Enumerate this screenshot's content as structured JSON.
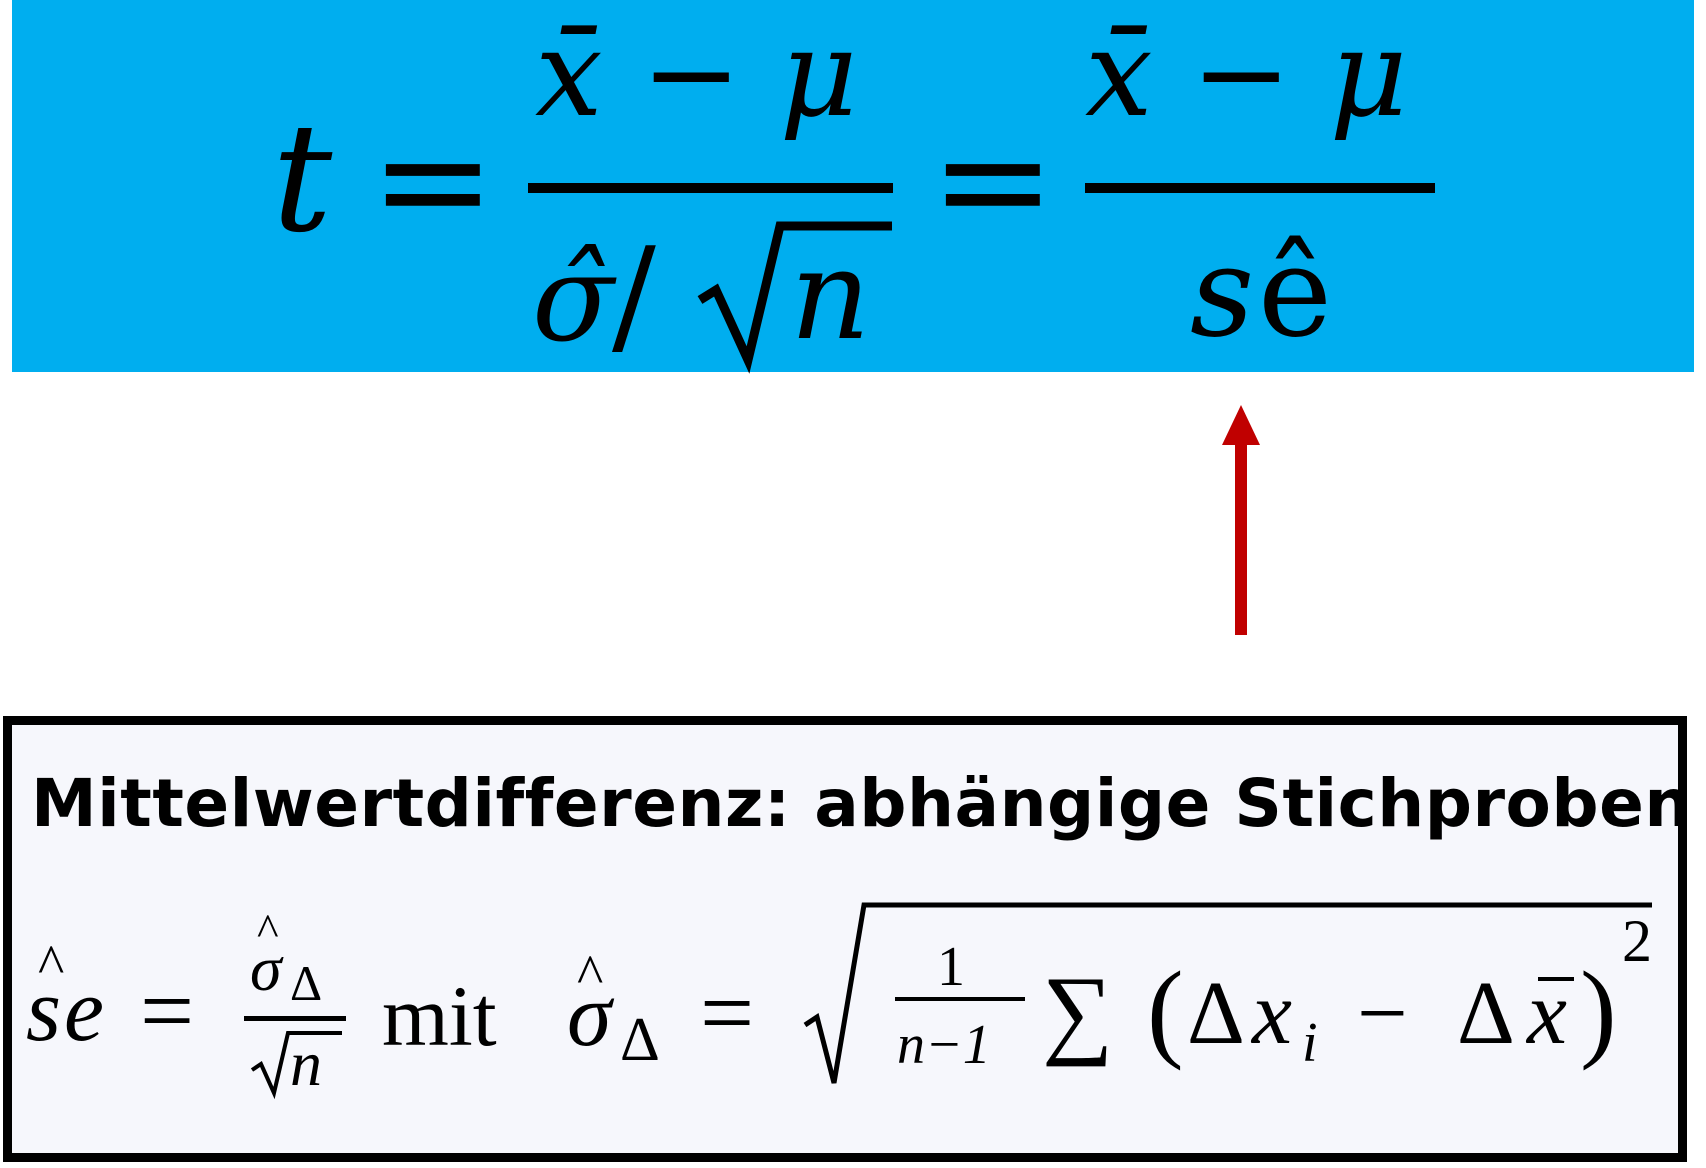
{
  "colors": {
    "panel_background": "#00aeef",
    "arrow": "#c00000",
    "box_border": "#000000",
    "box_background": "#f6f7fc"
  },
  "top_formula": {
    "lhs": "t",
    "equals": "=",
    "frac1_num": "x̄ − μ",
    "frac1_den_sigma": "σ̂",
    "frac1_den_slash": "/",
    "frac1_den_n": "n",
    "frac2_num": "x̄ − μ",
    "frac2_den_s": "s",
    "frac2_den_e": "ê"
  },
  "box": {
    "title": "Mittelwertdifferenz: abhängige Stichproben",
    "formula": {
      "se_s": "s",
      "se_e": "e",
      "equals": "=",
      "frac_num_sigma": "σ",
      "frac_num_sub": "Δ",
      "frac_den_n": "n",
      "mit": "mit",
      "sigma": "σ",
      "sigma_sub": "Δ",
      "inner_num": "1",
      "inner_den": "n−1",
      "sum": "∑",
      "paren_open": "(",
      "delta1": "Δ",
      "x_i": "x",
      "sub_i": "i",
      "minus": "−",
      "delta2": "Δ",
      "xbar": "x",
      "paren_close": ")",
      "exponent": "2"
    }
  }
}
